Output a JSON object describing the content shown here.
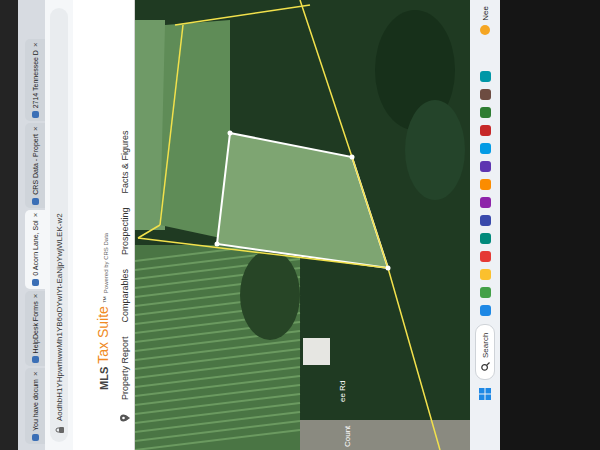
{
  "browser": {
    "tabs": [
      {
        "label": "You have docum",
        "selected": false
      },
      {
        "label": "HelpDesk Forms",
        "selected": false
      },
      {
        "label": "0 Acorn Lane, Sol",
        "selected": true
      },
      {
        "label": "CRS Data - Propert",
        "selected": false
      },
      {
        "label": "2714 Tennessee D",
        "selected": false
      }
    ],
    "tab_close": "×",
    "address": "AodhbH1YHpwrhwwMh1YB6oDYwlYt-EaNjpYwjWLEK-w2"
  },
  "app": {
    "logo": {
      "prefix": "MLS",
      "name": "Tax Suite",
      "mark": "™",
      "tagline": "Powered by CRS Data"
    },
    "nav": [
      "Property Report",
      "Comparables",
      "Prospecting",
      "Facts & Figures"
    ]
  },
  "map": {
    "road_labels": [
      "Count",
      "ee Rd"
    ]
  },
  "taskbar": {
    "search": "Search",
    "notification": "Nee"
  }
}
